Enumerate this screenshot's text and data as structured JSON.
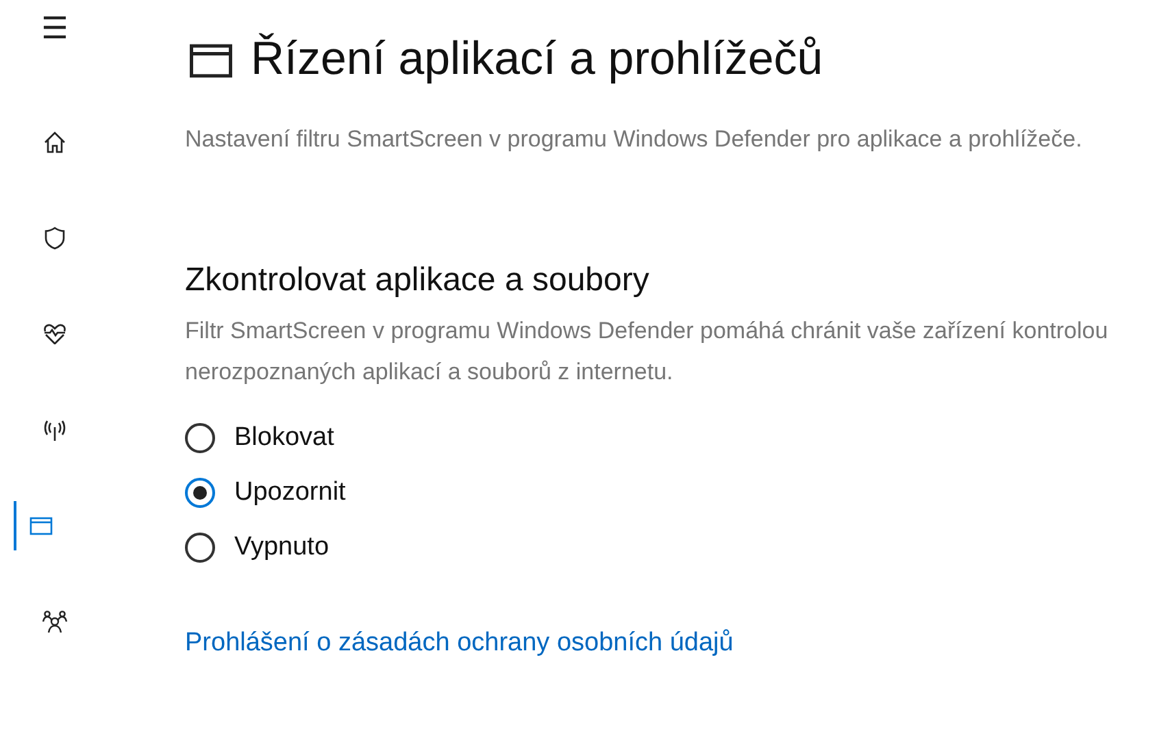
{
  "sidebar": {
    "menu_button": "☰",
    "items": [
      {
        "kind": "home",
        "selected": false
      },
      {
        "kind": "shield",
        "selected": false
      },
      {
        "kind": "health",
        "selected": false
      },
      {
        "kind": "network",
        "selected": false
      },
      {
        "kind": "browser",
        "selected": true
      },
      {
        "kind": "family",
        "selected": false
      }
    ]
  },
  "page": {
    "title": "Řízení aplikací a prohlížečů",
    "description": "Nastavení filtru SmartScreen v programu Windows Defender pro aplikace a prohlížeče."
  },
  "section": {
    "heading": "Zkontrolovat aplikace a soubory",
    "description": "Filtr SmartScreen v programu Windows Defender pomáhá chránit vaše zařízení kontrolou nerozpoznaných aplikací a souborů z internetu.",
    "options": [
      {
        "label": "Blokovat",
        "selected": false
      },
      {
        "label": "Upozornit",
        "selected": true
      },
      {
        "label": "Vypnuto",
        "selected": false
      }
    ]
  },
  "privacy_link": "Prohlášení o zásadách ochrany osobních údajů"
}
